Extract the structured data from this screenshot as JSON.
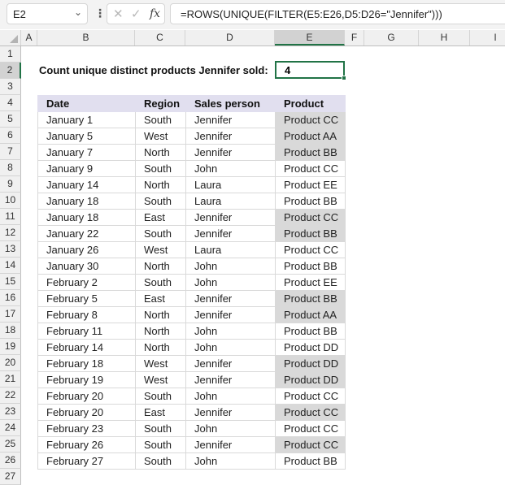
{
  "formula_bar": {
    "name_box": "E2",
    "formula": "=ROWS(UNIQUE(FILTER(E5:E26,D5:D26=\"Jennifer\")))",
    "icons": [
      "chevron-down-icon",
      "more-options-icon",
      "cancel-icon",
      "enter-icon",
      "fx-icon"
    ]
  },
  "columns": [
    "A",
    "B",
    "C",
    "D",
    "E",
    "F",
    "G",
    "H",
    "I"
  ],
  "rows": [
    "1",
    "2",
    "3",
    "4",
    "5",
    "6",
    "7",
    "8",
    "9",
    "10",
    "11",
    "12",
    "13",
    "14",
    "15",
    "16",
    "17",
    "18",
    "19",
    "20",
    "21",
    "22",
    "23",
    "24",
    "25",
    "26",
    "27"
  ],
  "selected_cell": "E2",
  "summary": {
    "label": "Count unique distinct products  Jennifer sold:",
    "value": "4"
  },
  "table": {
    "headers": [
      "Date",
      "Region",
      "Sales person",
      "Product"
    ],
    "rows": [
      {
        "date": "January 1",
        "region": "South",
        "person": "Jennifer",
        "product": "Product CC",
        "highlight": true
      },
      {
        "date": "January 5",
        "region": "West",
        "person": "Jennifer",
        "product": "Product AA",
        "highlight": true
      },
      {
        "date": "January 7",
        "region": "North",
        "person": "Jennifer",
        "product": "Product BB",
        "highlight": true
      },
      {
        "date": "January 9",
        "region": "South",
        "person": "John",
        "product": "Product CC",
        "highlight": false
      },
      {
        "date": "January 14",
        "region": "North",
        "person": "Laura",
        "product": "Product EE",
        "highlight": false
      },
      {
        "date": "January 18",
        "region": "South",
        "person": "Laura",
        "product": "Product BB",
        "highlight": false
      },
      {
        "date": "January 18",
        "region": "East",
        "person": "Jennifer",
        "product": "Product CC",
        "highlight": true
      },
      {
        "date": "January 22",
        "region": "South",
        "person": "Jennifer",
        "product": "Product BB",
        "highlight": true
      },
      {
        "date": "January 26",
        "region": "West",
        "person": "Laura",
        "product": "Product CC",
        "highlight": false
      },
      {
        "date": "January 30",
        "region": "North",
        "person": "John",
        "product": "Product BB",
        "highlight": false
      },
      {
        "date": "February 2",
        "region": "South",
        "person": "John",
        "product": "Product EE",
        "highlight": false
      },
      {
        "date": "February 5",
        "region": "East",
        "person": "Jennifer",
        "product": "Product BB",
        "highlight": true
      },
      {
        "date": "February 8",
        "region": "North",
        "person": "Jennifer",
        "product": "Product AA",
        "highlight": true
      },
      {
        "date": "February 11",
        "region": "North",
        "person": "John",
        "product": "Product BB",
        "highlight": false
      },
      {
        "date": "February 14",
        "region": "North",
        "person": "John",
        "product": "Product DD",
        "highlight": false
      },
      {
        "date": "February 18",
        "region": "West",
        "person": "Jennifer",
        "product": "Product DD",
        "highlight": true
      },
      {
        "date": "February 19",
        "region": "West",
        "person": "Jennifer",
        "product": "Product DD",
        "highlight": true
      },
      {
        "date": "February 20",
        "region": "South",
        "person": "John",
        "product": "Product CC",
        "highlight": false
      },
      {
        "date": "February 20",
        "region": "East",
        "person": "Jennifer",
        "product": "Product CC",
        "highlight": true
      },
      {
        "date": "February 23",
        "region": "South",
        "person": "John",
        "product": "Product CC",
        "highlight": false
      },
      {
        "date": "February 26",
        "region": "South",
        "person": "Jennifer",
        "product": "Product CC",
        "highlight": true
      },
      {
        "date": "February 27",
        "region": "South",
        "person": "John",
        "product": "Product BB",
        "highlight": false
      }
    ]
  },
  "colors": {
    "accent": "#217346",
    "header_fill": "#e1dfef",
    "highlight_fill": "#d9d9d9"
  }
}
